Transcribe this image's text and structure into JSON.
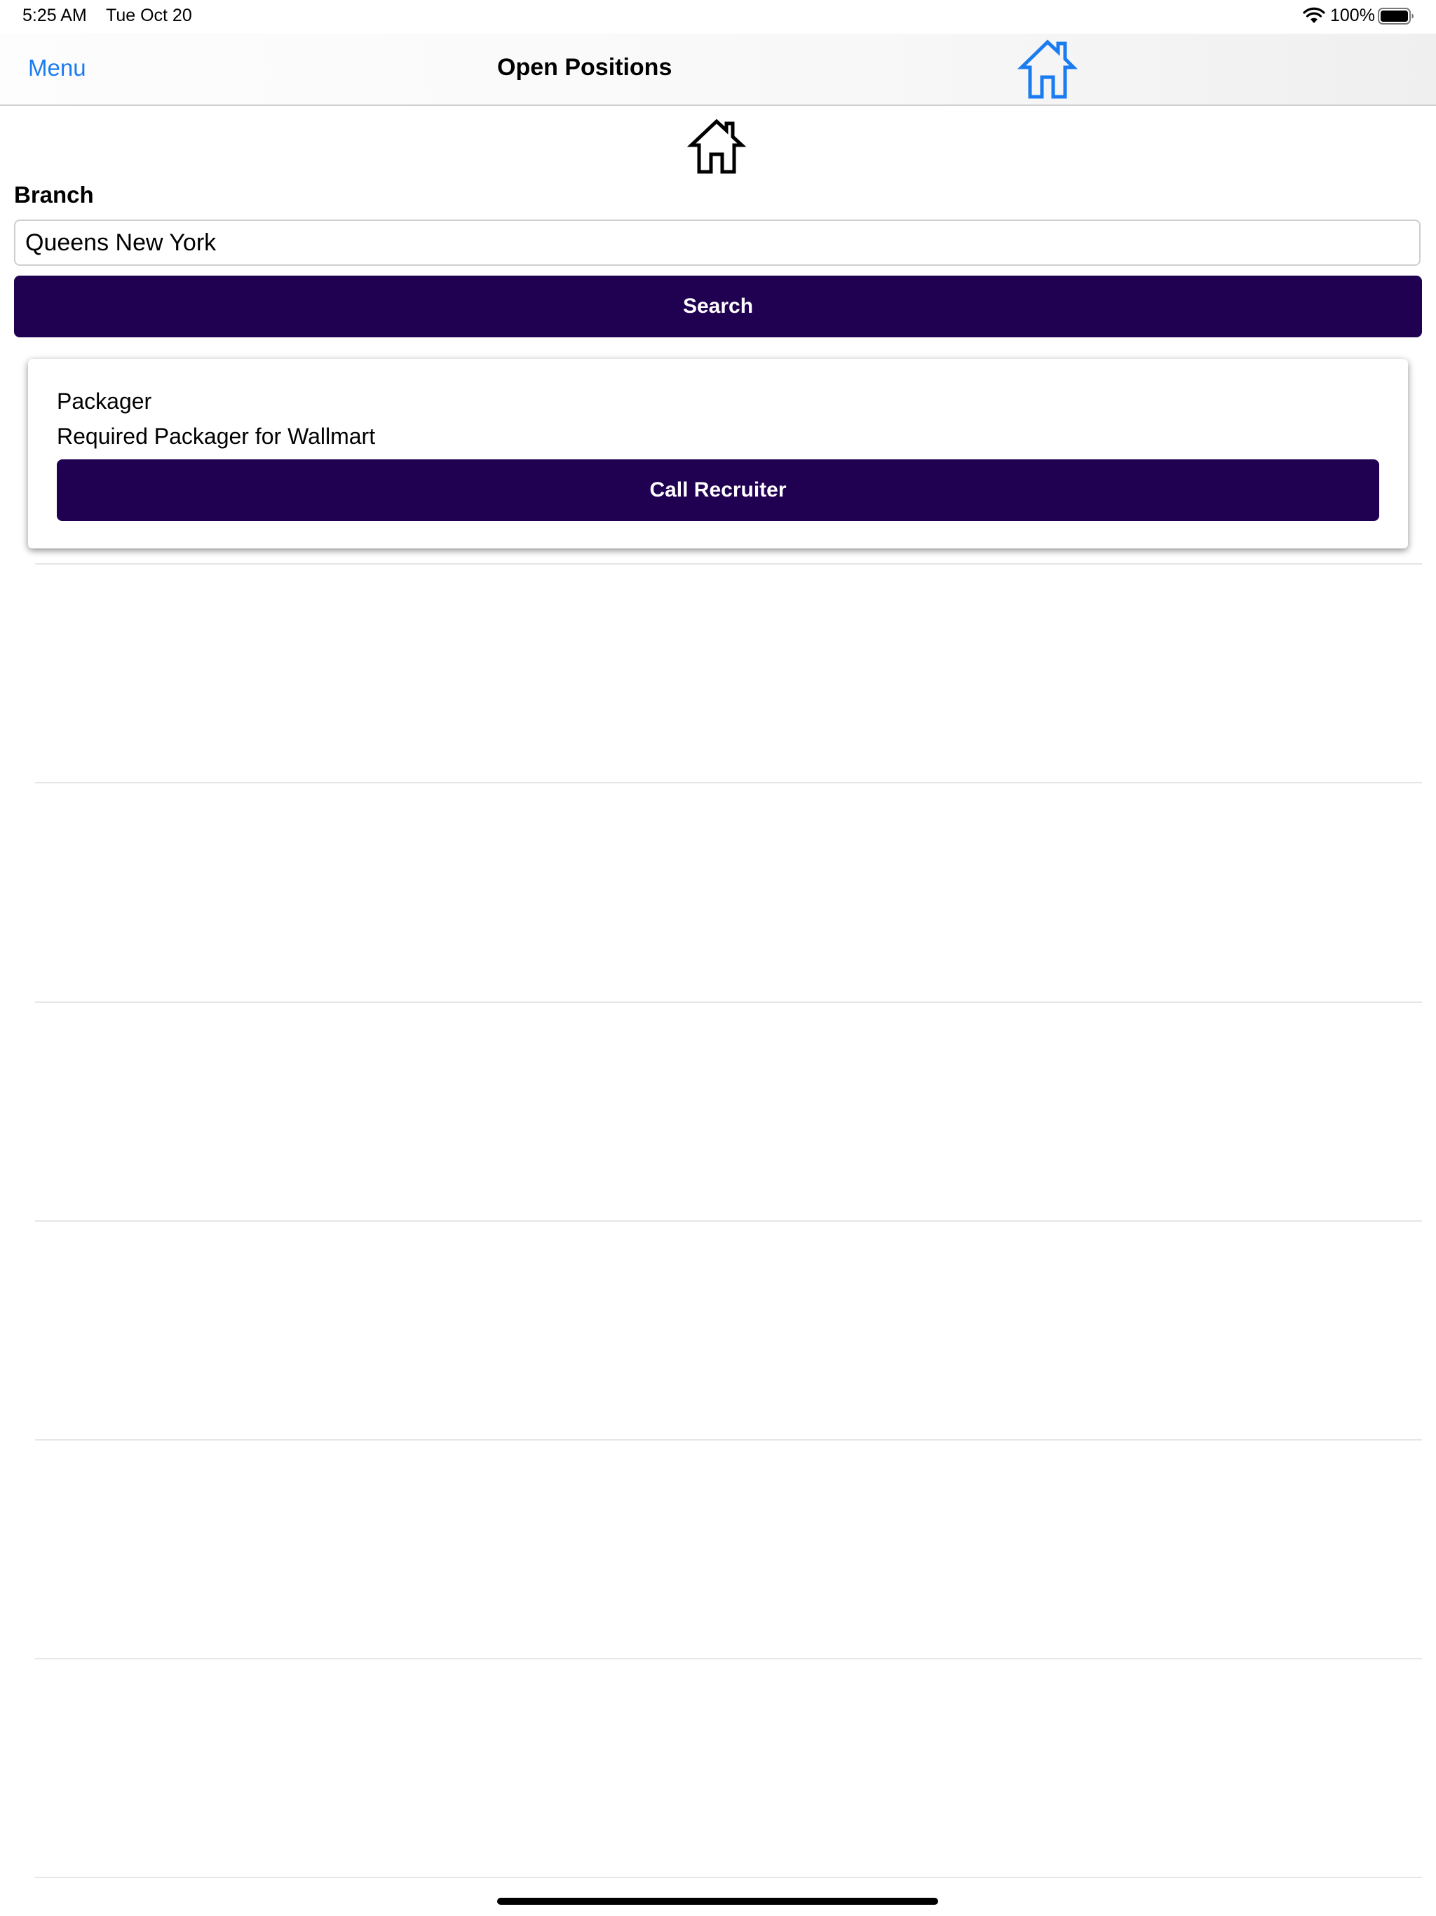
{
  "status_bar": {
    "time": "5:25 AM",
    "date": "Tue Oct 20",
    "battery_percent": "100%",
    "wifi_icon": "wifi-icon",
    "battery_icon": "battery-full-icon"
  },
  "nav": {
    "menu_label": "Menu",
    "title": "Open Positions",
    "home_icon": "home-icon",
    "accent_color": "#1a7cf0"
  },
  "header_icon": "home-icon",
  "branch": {
    "label": "Branch",
    "value": "Queens New York"
  },
  "search": {
    "button_label": "Search",
    "button_color": "#1f0051"
  },
  "results": [
    {
      "title": "Packager",
      "description": "Required Packager for Wallmart",
      "action_label": "Call Recruiter"
    }
  ]
}
